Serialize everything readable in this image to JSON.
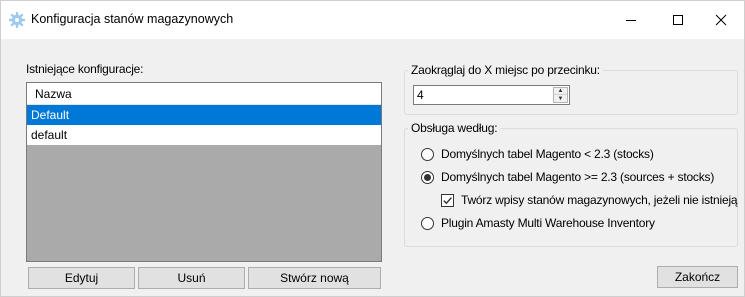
{
  "window": {
    "title": "Konfiguracja stanów magazynowych",
    "minimize_glyph": "—",
    "maximize_glyph": "☐",
    "close_glyph": "✕"
  },
  "configs": {
    "label": "Istniejące konfiguracje:",
    "column_header": "Nazwa",
    "rows": [
      {
        "name": "Default",
        "selected": true
      },
      {
        "name": "default",
        "selected": false
      }
    ]
  },
  "buttons": {
    "edit": "Edytuj",
    "delete": "Usuń",
    "create": "Stwórz nową",
    "finish": "Zakończ"
  },
  "rounding": {
    "label": "Zaokrąglaj do X miejsc po przecinku:",
    "value": "4"
  },
  "handling": {
    "label": "Obsługa według:",
    "options": [
      {
        "label": "Domyślnych tabel Magento < 2.3 (stocks)",
        "checked": false
      },
      {
        "label": "Domyślnych tabel Magento >= 2.3 (sources + stocks)",
        "checked": true
      },
      {
        "label": "Plugin Amasty Multi Warehouse Inventory",
        "checked": false
      }
    ],
    "create_records": {
      "label": "Twórz wpisy stanów magazynowych, jeżeli nie istnieją",
      "checked": true
    }
  },
  "colors": {
    "selection": "#0078d7",
    "list_background": "#aaaaaa",
    "window_background": "#f0f0f0"
  },
  "icons": {
    "app": "gear-icon",
    "spin_up": "arrow-up-icon",
    "spin_down": "arrow-down-icon",
    "check": "checkmark-icon"
  }
}
